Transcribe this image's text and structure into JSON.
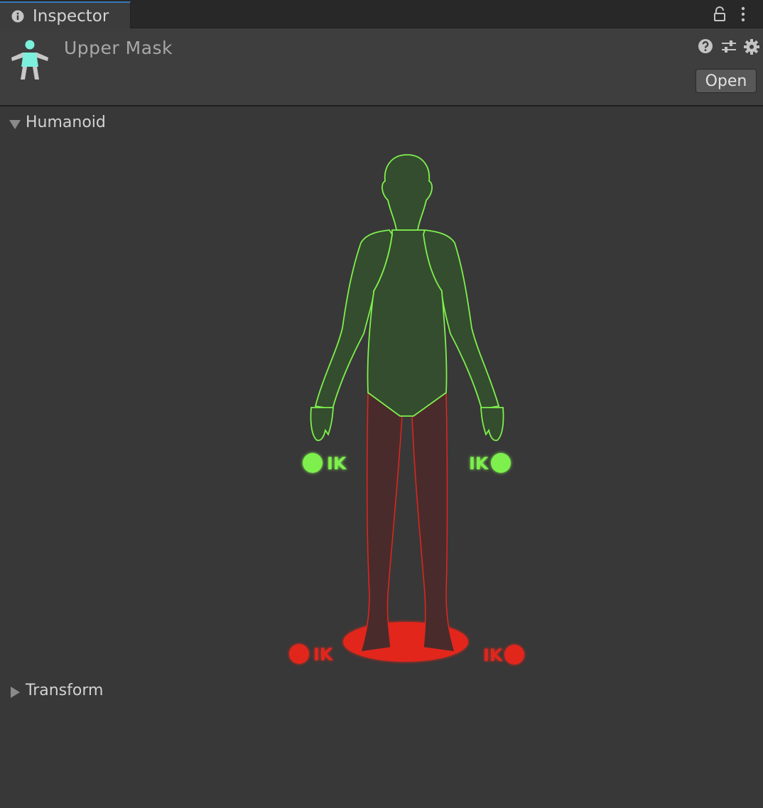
{
  "tab": {
    "label": "Inspector",
    "icon": "info-icon"
  },
  "toolbar_icons": [
    "lock-icon",
    "kebab-menu-icon"
  ],
  "header": {
    "title": "Upper Mask",
    "asset_icon": "avatar-mask-icon",
    "icons": [
      "help-icon",
      "preset-icon",
      "gear-icon"
    ],
    "open_label": "Open"
  },
  "sections": {
    "humanoid": {
      "label": "Humanoid",
      "expanded": true
    },
    "transform": {
      "label": "Transform",
      "expanded": false
    }
  },
  "humanoid": {
    "enabled_color": "#7ef04d",
    "disabled_color": "#e2261d",
    "body_parts": [
      {
        "name": "head",
        "enabled": true
      },
      {
        "name": "body",
        "enabled": true
      },
      {
        "name": "left-arm",
        "enabled": true
      },
      {
        "name": "right-arm",
        "enabled": true
      },
      {
        "name": "left-leg",
        "enabled": false
      },
      {
        "name": "right-leg",
        "enabled": false
      },
      {
        "name": "root",
        "enabled": false
      }
    ],
    "ik": {
      "left_hand": {
        "label": "IK",
        "enabled": true
      },
      "right_hand": {
        "label": "IK",
        "enabled": true
      },
      "left_foot": {
        "label": "IK",
        "enabled": false
      },
      "right_foot": {
        "label": "IK",
        "enabled": false
      }
    }
  }
}
